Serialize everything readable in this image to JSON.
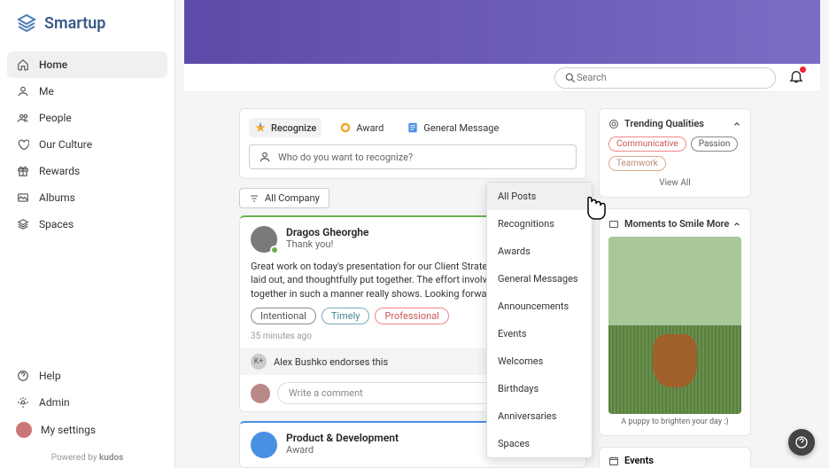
{
  "brand": {
    "name": "Smartup"
  },
  "nav": {
    "items": [
      {
        "label": "Home",
        "icon": "home",
        "active": true
      },
      {
        "label": "Me",
        "icon": "person"
      },
      {
        "label": "People",
        "icon": "people"
      },
      {
        "label": "Our Culture",
        "icon": "heart"
      },
      {
        "label": "Rewards",
        "icon": "gift"
      },
      {
        "label": "Albums",
        "icon": "albums"
      },
      {
        "label": "Spaces",
        "icon": "layers"
      }
    ],
    "bottom": [
      {
        "label": "Help",
        "icon": "help"
      },
      {
        "label": "Admin",
        "icon": "gear"
      },
      {
        "label": "My settings",
        "icon": "avatar"
      }
    ],
    "powered_prefix": "Powered by ",
    "powered_brand": "kudos"
  },
  "search": {
    "placeholder": "Search"
  },
  "compose": {
    "tabs": [
      {
        "label": "Recognize",
        "icon": "star"
      },
      {
        "label": "Award",
        "icon": "badge"
      },
      {
        "label": "General Message",
        "icon": "doc"
      }
    ],
    "placeholder": "Who do you want to recognize?"
  },
  "filter": {
    "label": "All Company"
  },
  "dropdown": {
    "items": [
      "All Posts",
      "Recognitions",
      "Awards",
      "General Messages",
      "Announcements",
      "Events",
      "Welcomes",
      "Birthdays",
      "Anniversaries",
      "Spaces"
    ],
    "selected": "All Posts"
  },
  "post1": {
    "author": "Dragos Gheorghe",
    "subtitle": "Thank you!",
    "body": "Great work on today's presentation for our Client Strategy. It was really well laid out, and thoughtfully put together. The effort involved in putting it together in such a manner really shows. Looking forward to the next steps.",
    "tags": [
      "Intentional",
      "Timely",
      "Professional"
    ],
    "time": "35 minutes ago",
    "endorse_initials": "K+",
    "endorse_text": "Alex Bushko endorses this",
    "comment_placeholder": "Write a comment"
  },
  "post2": {
    "author": "Product & Development",
    "subtitle": "Award"
  },
  "trending": {
    "title": "Trending Qualities",
    "tags": [
      "Communicative",
      "Passion",
      "Teamwork"
    ],
    "view_all": "View All"
  },
  "moments": {
    "title": "Moments to Smile More",
    "caption": "A puppy to brighten your day :)"
  },
  "events": {
    "title": "Events"
  }
}
